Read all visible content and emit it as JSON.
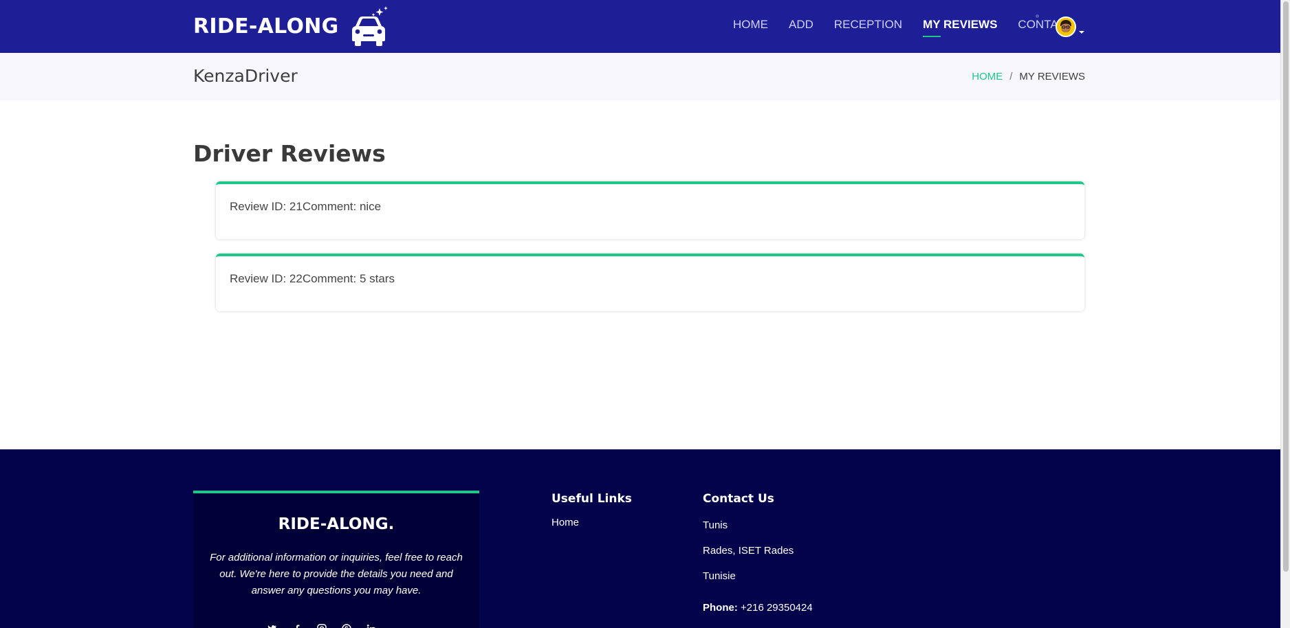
{
  "brand": {
    "name": "RIDE-ALONG"
  },
  "nav": {
    "items": [
      {
        "label": "HOME",
        "active": false
      },
      {
        "label": "ADD",
        "active": false
      },
      {
        "label": "RECEPTION",
        "active": false
      },
      {
        "label": "MY REVIEWS",
        "active": true
      },
      {
        "label": "CONTACT",
        "active": false
      }
    ]
  },
  "breadcrumb": {
    "user": "KenzaDriver",
    "home": "HOME",
    "separator": "/",
    "current": "MY REVIEWS"
  },
  "main": {
    "title": "Driver Reviews",
    "reviews": [
      {
        "text": "Review ID: 21Comment: nice"
      },
      {
        "text": "Review ID: 22Comment: 5 stars"
      }
    ]
  },
  "footer": {
    "brand_name": "RIDE-ALONG.",
    "description": "For additional information or inquiries, feel free to reach out. We're here to provide the details you need and answer any questions you may have.",
    "useful_links": {
      "title": "Useful Links",
      "links": [
        "Home"
      ]
    },
    "contact": {
      "title": "Contact Us",
      "lines": [
        "Tunis",
        "Rades, ISET Rades",
        "Tunisie"
      ],
      "phone_label": "Phone:",
      "phone_value": "+216 29350424"
    },
    "social_icons": [
      "twitter-icon",
      "facebook-icon",
      "instagram-icon",
      "skype-icon",
      "linkedin-icon"
    ]
  },
  "colors": {
    "header_bg": "#1e1e96",
    "accent": "#1cc88a",
    "footer_bg": "#03034b",
    "footer_brand_bg": "#000036"
  }
}
